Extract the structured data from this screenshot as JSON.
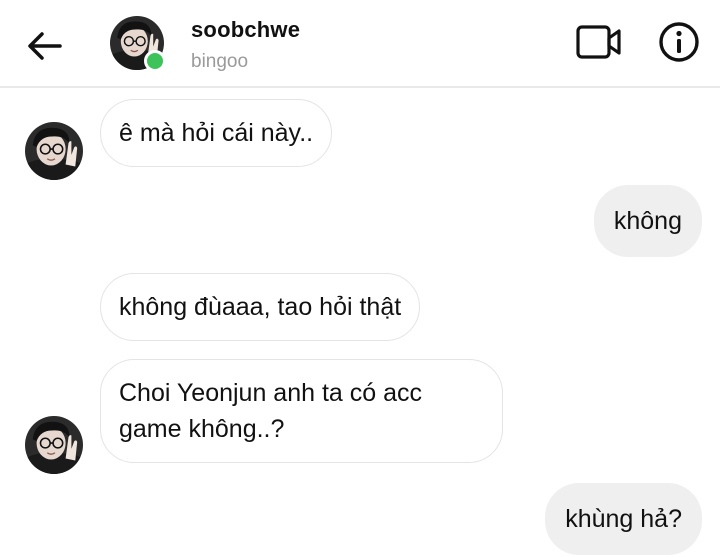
{
  "header": {
    "back_icon": "arrow-left-icon",
    "username": "soobchwe",
    "subname": "bingoo",
    "online": true,
    "video_icon": "video-camera-icon",
    "info_icon": "info-circle-icon"
  },
  "messages": [
    {
      "direction": "incoming",
      "text": "ê mà hỏi cái này..",
      "show_avatar": true
    },
    {
      "direction": "outgoing",
      "text": "không"
    },
    {
      "direction": "incoming",
      "text": "không đùaaa, tao hỏi thật",
      "show_avatar": false
    },
    {
      "direction": "incoming",
      "text": "Choi Yeonjun anh ta có acc game không..?",
      "show_avatar": true
    },
    {
      "direction": "outgoing",
      "text": "khùng hả?"
    }
  ],
  "colors": {
    "online_dot": "#3dc35a",
    "outgoing_bubble": "#efefef",
    "incoming_border": "#e4e4e4",
    "subtitle": "#9a9a9a"
  }
}
